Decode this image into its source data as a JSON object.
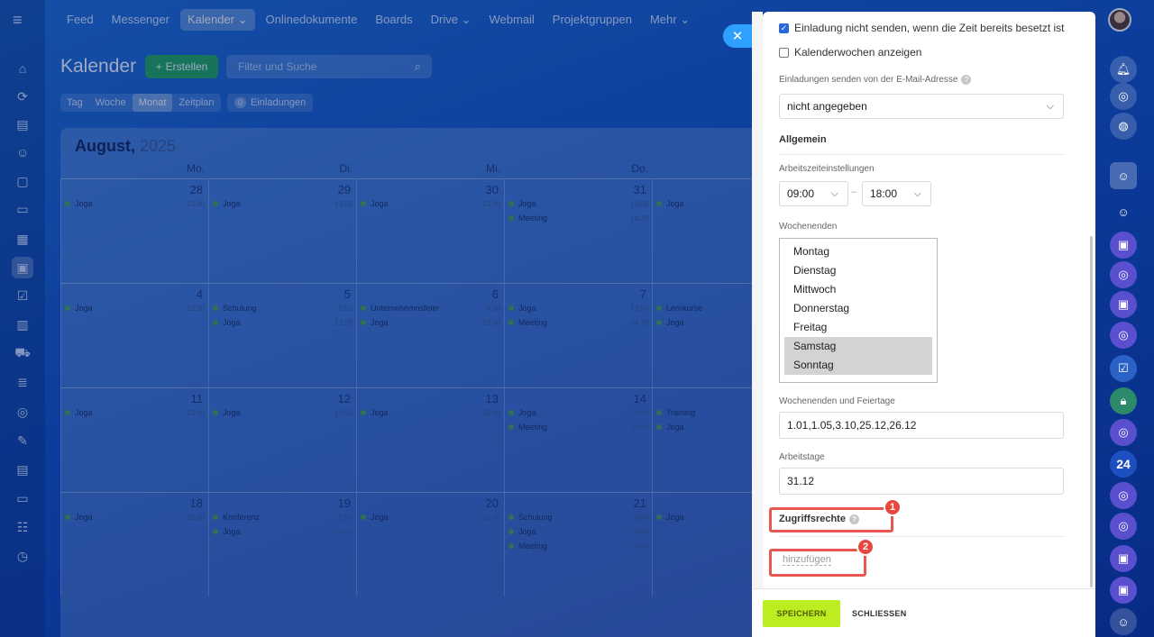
{
  "nav": {
    "items": [
      "Feed",
      "Messenger",
      "Kalender ⌄",
      "Onlinedokumente",
      "Boards",
      "Drive ⌄",
      "Webmail",
      "Projektgruppen",
      "Mehr ⌄"
    ],
    "active_index": 2
  },
  "calendar": {
    "title": "Kalender",
    "create_label": "Erstellen",
    "search_placeholder": "Filter und Suche",
    "view_tabs": [
      "Tag",
      "Woche",
      "Monat",
      "Zeitplan"
    ],
    "active_view": 2,
    "invitations_count": "0",
    "invitations_label": "Einladungen",
    "month": "August,",
    "year": "2025",
    "weekdays": [
      "Mo.",
      "Di.",
      "Mi.",
      "Do."
    ],
    "weeks": [
      {
        "days": [
          {
            "num": "28",
            "events": [
              {
                "name": "Joga",
                "time": "13:00"
              }
            ]
          },
          {
            "num": "29",
            "events": [
              {
                "name": "Joga",
                "time": "13:00"
              }
            ]
          },
          {
            "num": "30",
            "events": [
              {
                "name": "Joga",
                "time": "13:00"
              }
            ]
          },
          {
            "num": "31",
            "events": [
              {
                "name": "Joga",
                "time": "13:00"
              },
              {
                "name": "Meeting",
                "time": "14:20"
              }
            ]
          },
          {
            "num": "",
            "events": [
              {
                "name": "Joga",
                "time": ""
              }
            ]
          }
        ]
      },
      {
        "days": [
          {
            "num": "4",
            "events": [
              {
                "name": "Joga",
                "time": "13:00"
              }
            ]
          },
          {
            "num": "5",
            "events": [
              {
                "name": "Schulung",
                "time": "9:50"
              },
              {
                "name": "Joga",
                "time": "13:00"
              }
            ]
          },
          {
            "num": "6",
            "events": [
              {
                "name": "Unternehemnsfeier",
                "time": "9:50"
              },
              {
                "name": "Joga",
                "time": "13:00"
              }
            ]
          },
          {
            "num": "7",
            "events": [
              {
                "name": "Joga",
                "time": "13:00"
              },
              {
                "name": "Meeting",
                "time": "14:20"
              }
            ]
          },
          {
            "num": "",
            "events": [
              {
                "name": "Lernkurse",
                "time": ""
              },
              {
                "name": "Joga",
                "time": ""
              }
            ]
          }
        ]
      },
      {
        "days": [
          {
            "num": "11",
            "events": [
              {
                "name": "Joga",
                "time": "13:00"
              }
            ]
          },
          {
            "num": "12",
            "events": [
              {
                "name": "Joga",
                "time": "13:00"
              }
            ]
          },
          {
            "num": "13",
            "events": [
              {
                "name": "Joga",
                "time": "13:00"
              }
            ]
          },
          {
            "num": "14",
            "events": [
              {
                "name": "Joga",
                "time": "13:00"
              },
              {
                "name": "Meeting",
                "time": "14:20"
              }
            ]
          },
          {
            "num": "",
            "events": [
              {
                "name": "Training",
                "time": ""
              },
              {
                "name": "Joga",
                "time": ""
              }
            ]
          }
        ]
      },
      {
        "days": [
          {
            "num": "18",
            "events": [
              {
                "name": "Joga",
                "time": "13:00"
              }
            ]
          },
          {
            "num": "19",
            "events": [
              {
                "name": "Konferenz",
                "time": "9:50"
              },
              {
                "name": "Joga",
                "time": "13:00"
              }
            ]
          },
          {
            "num": "20",
            "events": [
              {
                "name": "Joga",
                "time": "13:00"
              }
            ]
          },
          {
            "num": "21",
            "events": [
              {
                "name": "Schulung",
                "time": "9:50"
              },
              {
                "name": "Joga",
                "time": "13:00"
              },
              {
                "name": "Meeting",
                "time": "14:20"
              }
            ]
          },
          {
            "num": "",
            "events": [
              {
                "name": "Joga",
                "time": ""
              }
            ]
          }
        ]
      }
    ]
  },
  "panel": {
    "opt_no_invite": "Einladung nicht senden, wenn die Zeit bereits besetzt ist",
    "opt_weeks": "Kalenderwochen anzeigen",
    "invite_email_label": "Einladungen senden von der E-Mail-Adresse",
    "invite_email_value": "nicht angegeben",
    "section_general": "Allgemein",
    "worktime_label": "Arbeitszeiteinstellungen",
    "work_from": "09:00",
    "work_to": "18:00",
    "time_sep": "–",
    "weekends_label": "Wochenenden",
    "weekdays_list": [
      "Montag",
      "Dienstag",
      "Mittwoch",
      "Donnerstag",
      "Freitag",
      "Samstag",
      "Sonntag"
    ],
    "weekends_selected": [
      5,
      6
    ],
    "holidays_label": "Wochenenden und Feiertage",
    "holidays_value": "1.01,1.05,3.10,25.12,26.12",
    "workdays_label": "Arbeitstage",
    "workdays_value": "31.12",
    "access_label": "Zugriffsrechte",
    "add_link": "hinzufügen",
    "save_label": "SPEICHERN",
    "close_label": "SCHLIESSEN",
    "badge1": "1",
    "badge2": "2"
  },
  "rail": {
    "number_badge": "24"
  },
  "colors": {
    "accent": "#2a67d8",
    "save": "#bbed21",
    "badge": "#e8473f",
    "event_dot": "#4ea34e",
    "create": "#23a85a"
  }
}
